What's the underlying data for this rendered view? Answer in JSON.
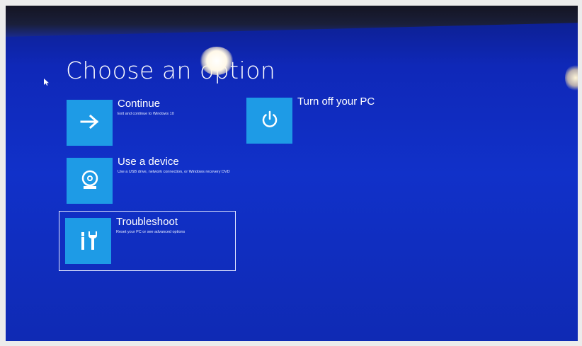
{
  "page": {
    "title": "Choose an option"
  },
  "colors": {
    "background": "#1131c9",
    "tile": "#1e9be6",
    "text": "#ffffff"
  },
  "options": [
    {
      "label": "Continue",
      "description": "Exit and continue to Windows 10",
      "icon": "arrow-right-icon"
    },
    {
      "label": "Use a device",
      "description": "Use a USB drive, network connection, or Windows recovery DVD",
      "icon": "disc-drive-icon"
    },
    {
      "label": "Troubleshoot",
      "description": "Reset your PC or see advanced options",
      "icon": "tools-icon",
      "focused": true
    },
    {
      "label": "Turn off your PC",
      "description": "",
      "icon": "power-icon"
    }
  ]
}
